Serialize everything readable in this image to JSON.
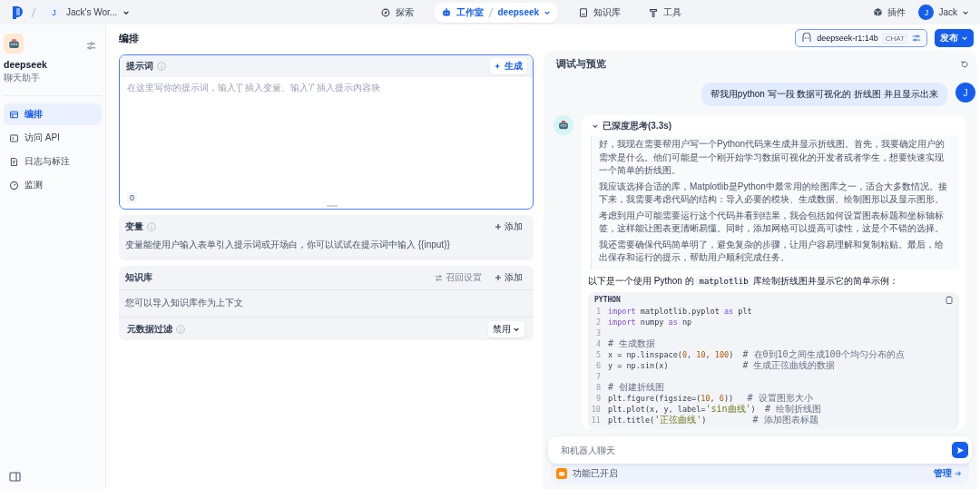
{
  "topbar": {
    "workspace_initial": "J",
    "workspace_name": "Jack's Wor...",
    "nav": [
      {
        "label": "探索",
        "selected": false
      },
      {
        "label": "工作室",
        "selected": true,
        "app": "deepseek"
      },
      {
        "label": "知识库",
        "selected": false
      },
      {
        "label": "工具",
        "selected": false
      }
    ],
    "plugins": "插件",
    "user_initial": "J",
    "user_name": "Jack"
  },
  "sidebar": {
    "app_name": "deepseek",
    "app_type": "聊天助手",
    "items": [
      {
        "label": "编排",
        "selected": true
      },
      {
        "label": "访问 API",
        "selected": false
      },
      {
        "label": "日志与标注",
        "selected": false
      },
      {
        "label": "监测",
        "selected": false
      }
    ]
  },
  "header": {
    "title": "编排",
    "model": "deepseek-r1:14b",
    "model_badge": "CHAT",
    "publish": "发布"
  },
  "prompt": {
    "title": "提示词",
    "generate": "生成",
    "placeholder": "在这里写你的提示词，输入'{' 插入变量、输入'/' 插入提示内容块",
    "count": "0"
  },
  "variables": {
    "title": "变量",
    "add": "添加",
    "description": "变量能使用户输入表单引入提示词或开场白，你可以试试在提示词中输入 {{input}}"
  },
  "knowledge": {
    "title": "知识库",
    "retrieval": "召回设置",
    "retrieval_disabled": true,
    "add": "添加",
    "description": "您可以导入知识库作为上下文",
    "filter_label": "元数据过滤",
    "filter_value": "禁用"
  },
  "preview": {
    "title": "调试与预览",
    "user_initial": "J",
    "user_message": "帮我用python 写一段 数据可视化的 折线图 并且显示出来",
    "thinking": {
      "label": "已深度思考(3.3s)",
      "expanded": true,
      "paragraphs": [
        "好，我现在需要帮用户写一个Python代码来生成并显示折线图。首先，我要确定用户的需求是什么。他们可能是一个刚开始学习数据可视化的开发者或者学生，想要快速实现一个简单的折线图。",
        "我应该选择合适的库，Matplotlib是Python中最常用的绘图库之一，适合大多数情况。接下来，我需要考虑代码的结构：导入必要的模块、生成数据、绘制图形以及显示图形。",
        "考虑到用户可能需要运行这个代码并看到结果，我会包括如何设置图表标题和坐标轴标签，这样能让图表更清晰易懂。同时，添加网格可以提高可读性，这是个不错的选择。",
        "我还需要确保代码简单明了，避免复杂的步骤，让用户容易理解和复制粘贴。最后，给出保存和运行的提示，帮助用户顺利完成任务。"
      ]
    },
    "intro": [
      {
        "kind": "text",
        "text": "以下是一个使用 Python 的 "
      },
      {
        "kind": "code",
        "text": "matplotlib"
      },
      {
        "kind": "text",
        "text": " 库绘制折线图并显示它的简单示例："
      }
    ],
    "code": {
      "language": "PYTHON",
      "lines": [
        {
          "n": "1",
          "tokens": [
            {
              "kind": "keyword",
              "text": "import"
            },
            {
              "kind": "plain",
              "text": " matplotlib.pyplot "
            },
            {
              "kind": "keyword",
              "text": "as"
            },
            {
              "kind": "plain",
              "text": " plt"
            }
          ]
        },
        {
          "n": "2",
          "tokens": [
            {
              "kind": "keyword",
              "text": "import"
            },
            {
              "kind": "plain",
              "text": " numpy "
            },
            {
              "kind": "keyword",
              "text": "as"
            },
            {
              "kind": "plain",
              "text": " np"
            }
          ]
        },
        {
          "n": "3"
        },
        {
          "n": "4",
          "tokens": [
            {
              "kind": "comment",
              "text": "# 生成数据"
            }
          ]
        },
        {
          "n": "5",
          "tokens": [
            {
              "kind": "plain",
              "text": "x = np.linspace("
            },
            {
              "kind": "number",
              "text": "0"
            },
            {
              "kind": "plain",
              "text": ", "
            },
            {
              "kind": "number",
              "text": "10"
            },
            {
              "kind": "plain",
              "text": ", "
            },
            {
              "kind": "number",
              "text": "100"
            },
            {
              "kind": "plain",
              "text": ")  "
            },
            {
              "kind": "comment",
              "text": "# 在0到10之间生成100个均匀分布的点"
            }
          ]
        },
        {
          "n": "6",
          "tokens": [
            {
              "kind": "plain",
              "text": "y = np.sin(x)                "
            },
            {
              "kind": "comment",
              "text": "# 生成正弦曲线的数据"
            }
          ]
        },
        {
          "n": "7"
        },
        {
          "n": "8",
          "tokens": [
            {
              "kind": "comment",
              "text": "# 创建折线图"
            }
          ]
        },
        {
          "n": "9",
          "tokens": [
            {
              "kind": "plain",
              "text": "plt.figure(figsize=("
            },
            {
              "kind": "number",
              "text": "10"
            },
            {
              "kind": "plain",
              "text": ", "
            },
            {
              "kind": "number",
              "text": "6"
            },
            {
              "kind": "plain",
              "text": "))   "
            },
            {
              "kind": "comment",
              "text": "# 设置图形大小"
            }
          ]
        },
        {
          "n": "10",
          "tokens": [
            {
              "kind": "plain",
              "text": "plt.plot(x, y, label="
            },
            {
              "kind": "string",
              "text": "'sin曲线'"
            },
            {
              "kind": "plain",
              "text": ")  "
            },
            {
              "kind": "comment",
              "text": "# 绘制折线图"
            }
          ]
        },
        {
          "n": "11",
          "tokens": [
            {
              "kind": "plain",
              "text": "plt.title("
            },
            {
              "kind": "string",
              "text": "'正弦曲线'"
            },
            {
              "kind": "plain",
              "text": ")          "
            },
            {
              "kind": "comment",
              "text": "# 添加图表标题"
            }
          ]
        }
      ]
    },
    "input_placeholder": "和机器人聊天",
    "feature_status": "功能已开启",
    "manage": "管理"
  }
}
